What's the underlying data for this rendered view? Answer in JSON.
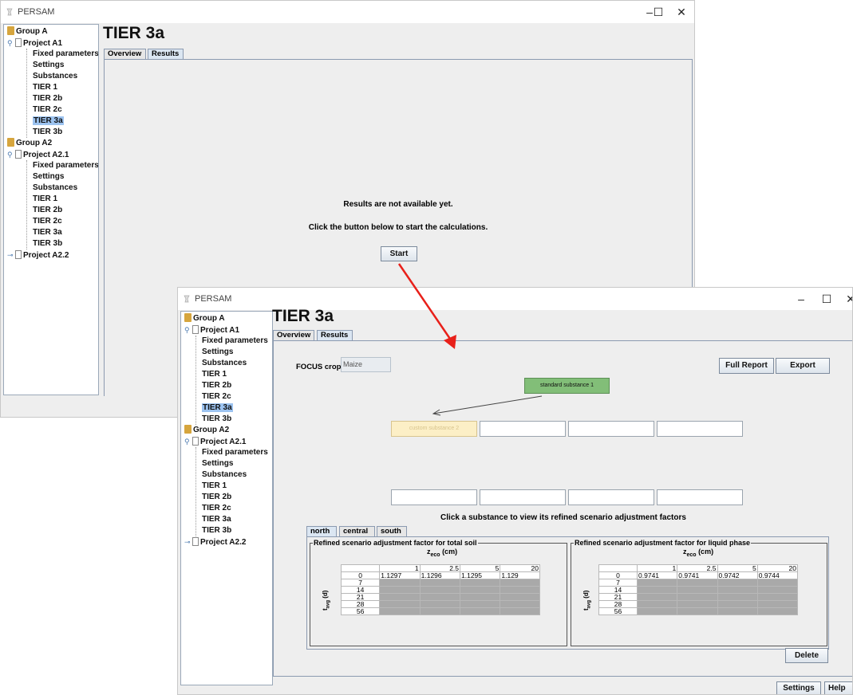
{
  "app": {
    "title": "PERSAM",
    "minimize": "–",
    "maximize": "☐",
    "close": "✕"
  },
  "tree": {
    "group_a": "Group A",
    "project_a1": "Project A1",
    "a1_items": [
      "Fixed parameters",
      "Settings",
      "Substances",
      "TIER 1",
      "TIER 2b",
      "TIER 2c",
      "TIER 3a",
      "TIER 3b"
    ],
    "group_a2": "Group A2",
    "project_a21": "Project A2.1",
    "a21_items": [
      "Fixed parameters",
      "Settings",
      "Substances",
      "TIER 1",
      "TIER 2b",
      "TIER 2c",
      "TIER 3a",
      "TIER 3b"
    ],
    "project_a22": "Project A2.2",
    "selected": "TIER 3a"
  },
  "page": {
    "title": "TIER 3a",
    "tabs": [
      "Overview",
      "Results"
    ],
    "active_tab": "Results"
  },
  "window1": {
    "message1": "Results are not available yet.",
    "message2": "Click the button below to start the calculations.",
    "start_button": "Start"
  },
  "window2": {
    "focus_label": "FOCUS crop:",
    "focus_value": "Maize",
    "full_report_button": "Full Report",
    "export_button": "Export",
    "standard_substance": "standard substance 1",
    "custom_substance": "custom substance 2",
    "hint": "Click a substance to view its refined scenario adjustment factors",
    "region_tabs": [
      "north",
      "central",
      "south"
    ],
    "active_region": "north",
    "total_soil": {
      "title": "Refined scenario adjustment factor for total soil",
      "zeco_label": "z",
      "zeco_sub": "eco",
      "zeco_unit": " (cm)",
      "tavg_label": "t",
      "tavg_sub": "avg",
      "tavg_unit": " (d)",
      "columns": [
        "1",
        "2.5",
        "5",
        "20"
      ],
      "rows": [
        "0",
        "7",
        "14",
        "21",
        "28",
        "56"
      ],
      "row0_values": [
        "1.1297",
        "1.1296",
        "1.1295",
        "1.129"
      ]
    },
    "liquid_phase": {
      "title": "Refined scenario adjustment factor for liquid phase",
      "zeco_label": "z",
      "zeco_sub": "eco",
      "zeco_unit": " (cm)",
      "tavg_label": "t",
      "tavg_sub": "avg",
      "tavg_unit": " (d)",
      "columns": [
        "1",
        "2.5",
        "5",
        "20"
      ],
      "rows": [
        "0",
        "7",
        "14",
        "21",
        "28",
        "56"
      ],
      "row0_values": [
        "0.9741",
        "0.9741",
        "0.9742",
        "0.9744"
      ]
    },
    "delete_button": "Delete",
    "settings_button": "Settings",
    "help_button": "Help"
  },
  "colors": {
    "selection": "#9cc3f0",
    "standard_substance": "#82be78",
    "custom_substance": "#fcefc6",
    "arrow": "#e8201a",
    "disabled_cell": "#a9a9a9"
  }
}
